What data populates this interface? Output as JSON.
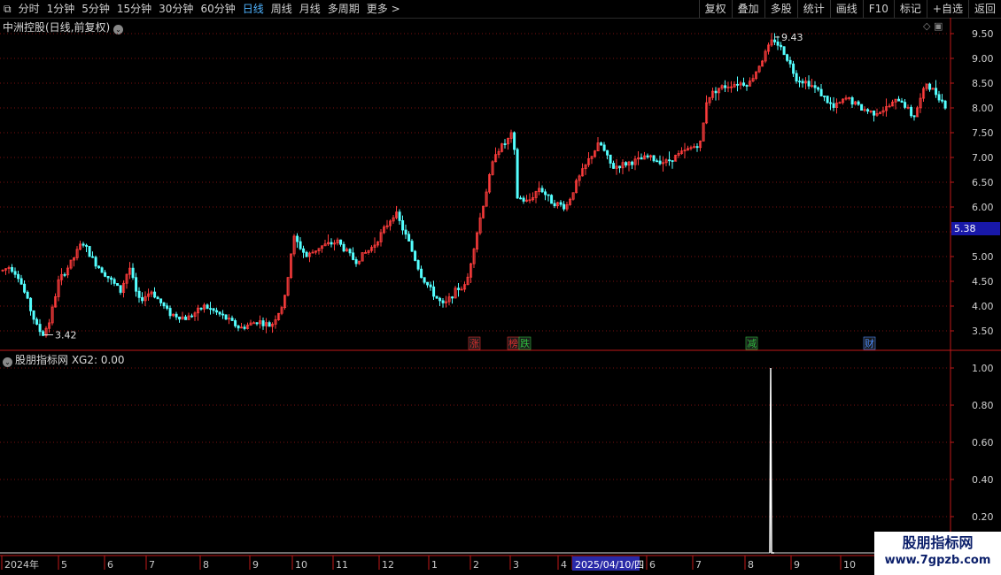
{
  "toolbar": {
    "periods": [
      "分时",
      "1分钟",
      "5分钟",
      "15分钟",
      "30分钟",
      "60分钟",
      "日线",
      "周线",
      "月线",
      "多周期",
      "更多 >"
    ],
    "active_period": "日线",
    "right_buttons": [
      "复权",
      "叠加",
      "多股",
      "统计",
      "画线",
      "F10",
      "标记",
      "+自选",
      "返回"
    ]
  },
  "main_chart": {
    "title": "中洲控股(日线,前复权)",
    "price_axis": [
      "9.50",
      "9.00",
      "8.50",
      "8.00",
      "7.50",
      "7.00",
      "6.50",
      "6.00",
      "5.50",
      "5.00",
      "4.50",
      "4.00",
      "3.50"
    ],
    "current_price": "5.38",
    "low_label": "3.42",
    "high_label": "9.43",
    "markers": [
      {
        "text": "涨",
        "color": "#e03030"
      },
      {
        "text": "榜",
        "color": "#e03030"
      },
      {
        "text": "跌",
        "color": "#2fc23f"
      },
      {
        "text": "减",
        "color": "#2fc23f"
      },
      {
        "text": "财",
        "color": "#4a8cff"
      }
    ]
  },
  "indicator": {
    "title": "股朋指标网 XG2: 0.00",
    "axis": [
      "1.00",
      "0.80",
      "0.60",
      "0.40",
      "0.20"
    ]
  },
  "date_axis": {
    "labels": [
      "2024年",
      "5",
      "6",
      "7",
      "8",
      "9",
      "10",
      "11",
      "12",
      "1",
      "2",
      "3",
      "4",
      "2025/04/10/四",
      "6",
      "7",
      "8",
      "9",
      "10"
    ]
  },
  "watermark": {
    "line1": "股朋指标网",
    "line2": "www.7gpzb.com"
  },
  "colors": {
    "up": "#ff3c3c",
    "down": "#54ffff",
    "grid": "#7a1010",
    "axis": "#c01818",
    "highlight": "#2a2aa8"
  },
  "chart_data": {
    "type": "candlestick",
    "price_range": [
      3.3,
      9.6
    ],
    "indicator_series": {
      "name": "XG2",
      "signal_value": 1.0,
      "baseline": 0.0
    },
    "path_points": [
      [
        0,
        4.7
      ],
      [
        10,
        4.8
      ],
      [
        20,
        4.6
      ],
      [
        30,
        4.1
      ],
      [
        40,
        3.6
      ],
      [
        47,
        3.42
      ],
      [
        55,
        3.7
      ],
      [
        65,
        4.5
      ],
      [
        80,
        4.9
      ],
      [
        92,
        5.3
      ],
      [
        105,
        4.9
      ],
      [
        120,
        4.6
      ],
      [
        135,
        4.3
      ],
      [
        145,
        4.8
      ],
      [
        155,
        4.1
      ],
      [
        170,
        4.3
      ],
      [
        190,
        3.85
      ],
      [
        210,
        3.75
      ],
      [
        230,
        4.0
      ],
      [
        250,
        3.8
      ],
      [
        270,
        3.55
      ],
      [
        290,
        3.7
      ],
      [
        305,
        3.6
      ],
      [
        320,
        4.1
      ],
      [
        330,
        5.4
      ],
      [
        345,
        5.0
      ],
      [
        360,
        5.2
      ],
      [
        380,
        5.3
      ],
      [
        400,
        4.9
      ],
      [
        420,
        5.2
      ],
      [
        445,
        5.9
      ],
      [
        460,
        5.3
      ],
      [
        475,
        4.6
      ],
      [
        490,
        4.2
      ],
      [
        500,
        4.0
      ],
      [
        515,
        4.35
      ],
      [
        525,
        4.4
      ],
      [
        535,
        5.3
      ],
      [
        545,
        6.1
      ],
      [
        558,
        7.1
      ],
      [
        570,
        7.3
      ],
      [
        578,
        7.5
      ],
      [
        583,
        6.2
      ],
      [
        595,
        6.1
      ],
      [
        608,
        6.4
      ],
      [
        622,
        6.1
      ],
      [
        638,
        6.0
      ],
      [
        650,
        6.5
      ],
      [
        665,
        7.0
      ],
      [
        676,
        7.3
      ],
      [
        690,
        6.8
      ],
      [
        710,
        6.9
      ],
      [
        730,
        7.0
      ],
      [
        750,
        6.9
      ],
      [
        770,
        7.1
      ],
      [
        790,
        7.3
      ],
      [
        797,
        8.2
      ],
      [
        810,
        8.4
      ],
      [
        830,
        8.5
      ],
      [
        845,
        8.5
      ],
      [
        860,
        9.0
      ],
      [
        872,
        9.4
      ],
      [
        885,
        9.1
      ],
      [
        898,
        8.6
      ],
      [
        912,
        8.5
      ],
      [
        925,
        8.3
      ],
      [
        940,
        8.0
      ],
      [
        955,
        8.2
      ],
      [
        970,
        8.0
      ],
      [
        985,
        7.9
      ],
      [
        1000,
        8.0
      ],
      [
        1015,
        8.2
      ],
      [
        1030,
        7.8
      ],
      [
        1045,
        8.5
      ],
      [
        1060,
        8.2
      ],
      [
        1068,
        8.0
      ]
    ]
  }
}
